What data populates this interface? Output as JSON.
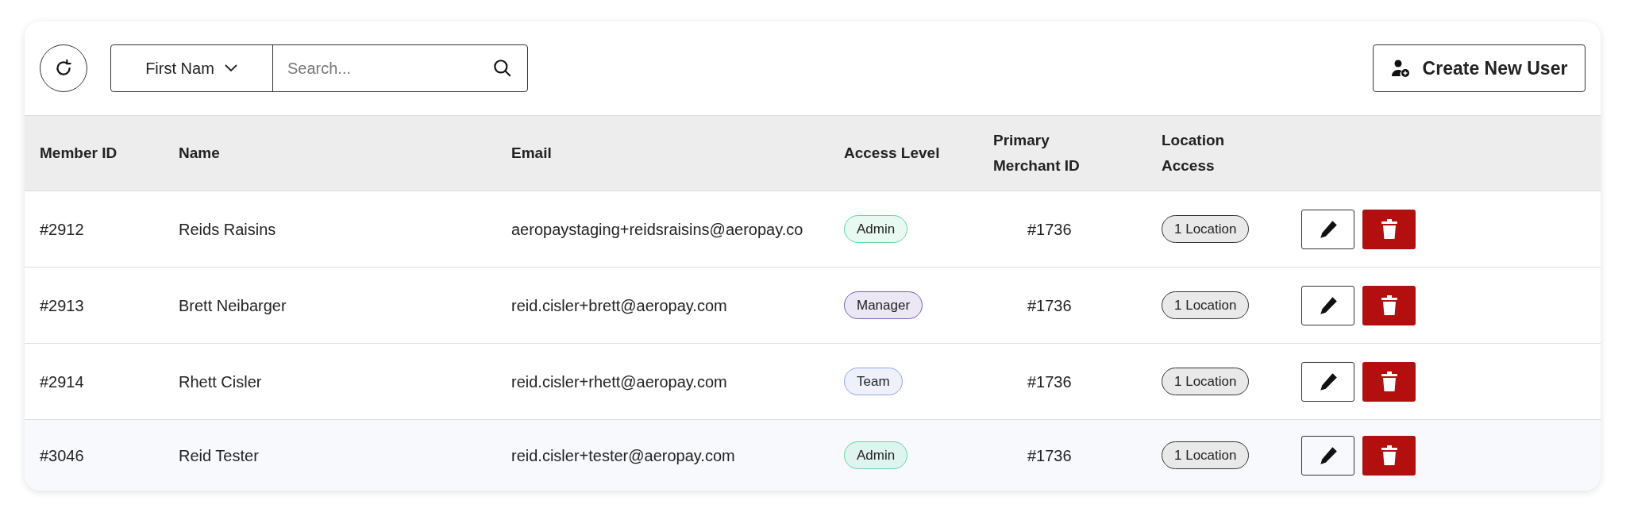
{
  "toolbar": {
    "filter_field": "First Nam",
    "search": {
      "placeholder": "Search..."
    },
    "create_button": "Create New User"
  },
  "table": {
    "columns": [
      "Member ID",
      "Name",
      "Email",
      "Access Level",
      "Primary Merchant ID",
      "Location Access"
    ],
    "rows": [
      {
        "member_id": "#2912",
        "name": "Reids Raisins",
        "email": "aeropaystaging+reidsraisins@aeropay.co",
        "access": {
          "label": "Admin",
          "color": "#5fd9a0"
        },
        "merchant_id": "#1736",
        "location": "1 Location",
        "selected": false
      },
      {
        "member_id": "#2913",
        "name": "Brett Neibarger",
        "email": "reid.cisler+brett@aeropay.com",
        "access": {
          "label": "Manager",
          "color": "#7b5cb8"
        },
        "merchant_id": "#1736",
        "location": "1 Location",
        "selected": false
      },
      {
        "member_id": "#2914",
        "name": "Rhett Cisler",
        "email": "reid.cisler+rhett@aeropay.com",
        "access": {
          "label": "Team",
          "color": "#8ea4e8"
        },
        "merchant_id": "#1736",
        "location": "1 Location",
        "selected": false
      },
      {
        "member_id": "#3046",
        "name": "Reid Tester",
        "email": "reid.cisler+tester@aeropay.com",
        "access": {
          "label": "Admin",
          "color": "#5fd9a0"
        },
        "merchant_id": "#1736",
        "location": "1 Location",
        "selected": true
      }
    ]
  }
}
